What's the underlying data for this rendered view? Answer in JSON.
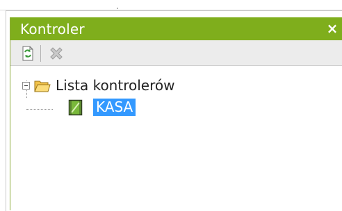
{
  "panel": {
    "title": "Kontroler",
    "close_symbol": "×",
    "accent_color": "#7fae1c"
  },
  "toolbar": {
    "buttons": [
      {
        "icon": "refresh-icon",
        "enabled": true
      },
      {
        "icon": "delete-icon",
        "enabled": false
      }
    ]
  },
  "tree": {
    "root": {
      "label": "Lista kontrolerów",
      "expanded": true,
      "icon": "folder-open-icon"
    },
    "children": [
      {
        "label": "KASA",
        "icon": "controller-icon",
        "selected": true
      }
    ]
  }
}
